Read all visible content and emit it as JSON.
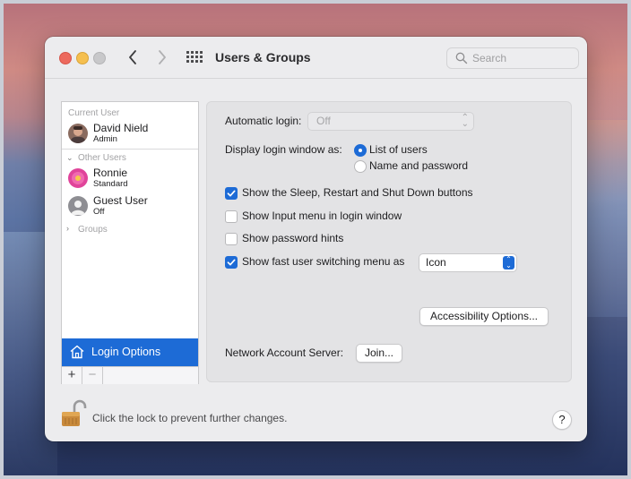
{
  "window": {
    "title": "Users & Groups",
    "search_placeholder": "Search"
  },
  "sidebar": {
    "current_user_header": "Current User",
    "current_user": {
      "name": "David Nield",
      "role": "Admin"
    },
    "other_users_header": "Other Users",
    "other_users": [
      {
        "name": "Ronnie",
        "role": "Standard"
      },
      {
        "name": "Guest User",
        "role": "Off"
      }
    ],
    "groups_header": "Groups",
    "login_options_label": "Login Options",
    "add_label": "+",
    "remove_label": "−"
  },
  "login_panel": {
    "automatic_login_label": "Automatic login:",
    "automatic_login_value": "Off",
    "display_login_label": "Display login window as:",
    "display_options": [
      {
        "label": "List of users",
        "selected": true
      },
      {
        "label": "Name and password",
        "selected": false
      }
    ],
    "checkboxes": [
      {
        "label": "Show the Sleep, Restart and Shut Down buttons",
        "checked": true
      },
      {
        "label": "Show Input menu in login window",
        "checked": false
      },
      {
        "label": "Show password hints",
        "checked": false
      },
      {
        "label": "Show fast user switching menu as",
        "checked": true
      }
    ],
    "fast_switch_value": "Icon",
    "accessibility_button": "Accessibility Options...",
    "network_server_label": "Network Account Server:",
    "join_button": "Join..."
  },
  "footer": {
    "lock_text": "Click the lock to prevent further changes.",
    "help_label": "?"
  },
  "colors": {
    "accent": "#1d6bd6",
    "close": "#ed6a5e",
    "minimize": "#f5bf4f"
  }
}
